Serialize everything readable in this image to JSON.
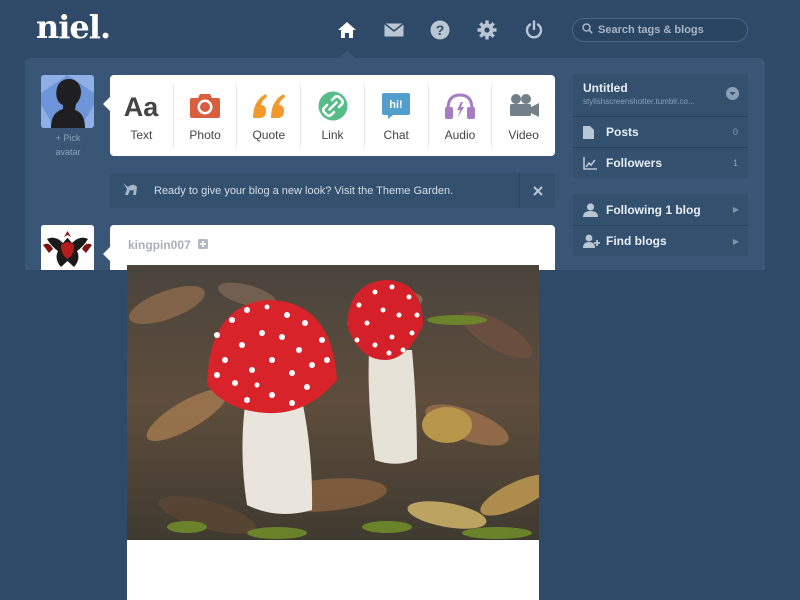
{
  "header": {
    "logo": "niel.",
    "nav": [
      "home-icon",
      "mail-icon",
      "help-icon",
      "gear-icon",
      "power-icon"
    ],
    "search_placeholder": "Search tags & blogs"
  },
  "pick_avatar": {
    "line1": "+ Pick",
    "line2": "avatar"
  },
  "post_types": [
    {
      "label": "Text",
      "icon": "text-icon",
      "color": "#444444"
    },
    {
      "label": "Photo",
      "icon": "camera-icon",
      "color": "#d95e40"
    },
    {
      "label": "Quote",
      "icon": "quote-icon",
      "color": "#f2992e"
    },
    {
      "label": "Link",
      "icon": "link-icon",
      "color": "#56bc8a"
    },
    {
      "label": "Chat",
      "icon": "chat-icon",
      "color": "#529ecc"
    },
    {
      "label": "Audio",
      "icon": "audio-icon",
      "color": "#a77dc2"
    },
    {
      "label": "Video",
      "icon": "video-icon",
      "color": "#748089"
    }
  ],
  "theme_notice": "Ready to give your blog a new look? Visit the Theme Garden.",
  "sidebar": {
    "blog_title": "Untitled",
    "blog_url": "stylishscreenshotter.tumblr.co...",
    "stats": [
      {
        "label": "Posts",
        "count": "0",
        "icon": "document-icon"
      },
      {
        "label": "Followers",
        "count": "1",
        "icon": "chart-icon"
      }
    ],
    "links": [
      {
        "label": "Following 1 blog",
        "icon": "person-icon"
      },
      {
        "label": "Find blogs",
        "icon": "add-person-icon"
      }
    ]
  },
  "post": {
    "username": "kingpin007"
  },
  "colors": {
    "background": "#2f4a68",
    "panel": "#3a5676"
  }
}
